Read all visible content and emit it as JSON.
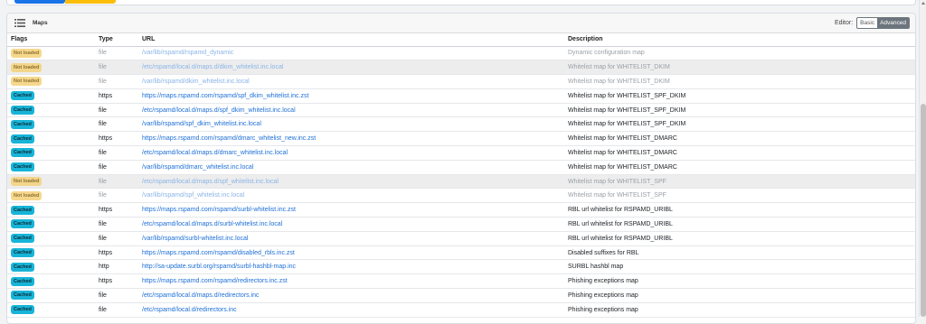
{
  "card": {
    "title": "Maps",
    "editor_label": "Editor:",
    "editor_basic": "Basic",
    "editor_advanced": "Advanced"
  },
  "table": {
    "headers": [
      "Flags",
      "Type",
      "URL",
      "Description"
    ],
    "rows": [
      {
        "flag": "Not loaded",
        "type": "file",
        "url": "/var/lib/rspamd/rspamd_dynamic",
        "desc": "Dynamic configuration map",
        "dim": true,
        "grey": false
      },
      {
        "flag": "Not loaded",
        "type": "file",
        "url": "/etc/rspamd/local.d/maps.d/dkim_whitelist.inc.local",
        "desc": "Whitelist map for WHITELIST_DKIM",
        "dim": true,
        "grey": true
      },
      {
        "flag": "Not loaded",
        "type": "file",
        "url": "/var/lib/rspamd/dkim_whitelist.inc.local",
        "desc": "Whitelist map for WHITELIST_DKIM",
        "dim": true,
        "grey": false
      },
      {
        "flag": "Cached",
        "type": "https",
        "url": "https://maps.rspamd.com/rspamd/spf_dkim_whitelist.inc.zst",
        "desc": "Whitelist map for WHITELIST_SPF_DKIM",
        "dim": false,
        "grey": false
      },
      {
        "flag": "Cached",
        "type": "file",
        "url": "/etc/rspamd/local.d/maps.d/spf_dkim_whitelist.inc.local",
        "desc": "Whitelist map for WHITELIST_SPF_DKIM",
        "dim": false,
        "grey": false
      },
      {
        "flag": "Cached",
        "type": "file",
        "url": "/var/lib/rspamd/spf_dkim_whitelist.inc.local",
        "desc": "Whitelist map for WHITELIST_SPF_DKIM",
        "dim": false,
        "grey": false
      },
      {
        "flag": "Cached",
        "type": "https",
        "url": "https://maps.rspamd.com/rspamd/dmarc_whitelist_new.inc.zst",
        "desc": "Whitelist map for WHITELIST_DMARC",
        "dim": false,
        "grey": false
      },
      {
        "flag": "Cached",
        "type": "file",
        "url": "/etc/rspamd/local.d/maps.d/dmarc_whitelist.inc.local",
        "desc": "Whitelist map for WHITELIST_DMARC",
        "dim": false,
        "grey": false
      },
      {
        "flag": "Cached",
        "type": "file",
        "url": "/var/lib/rspamd/dmarc_whitelist.inc.local",
        "desc": "Whitelist map for WHITELIST_DMARC",
        "dim": false,
        "grey": false
      },
      {
        "flag": "Not loaded",
        "type": "file",
        "url": "/etc/rspamd/local.d/maps.d/spf_whitelist.inc.local",
        "desc": "Whitelist map for WHITELIST_SPF",
        "dim": true,
        "grey": true
      },
      {
        "flag": "Not loaded",
        "type": "file",
        "url": "/var/lib/rspamd/spf_whitelist.inc.local",
        "desc": "Whitelist map for WHITELIST_SPF",
        "dim": true,
        "grey": false
      },
      {
        "flag": "Cached",
        "type": "https",
        "url": "https://maps.rspamd.com/rspamd/surbl-whitelist.inc.zst",
        "desc": "RBL url whitelist for RSPAMD_URIBL",
        "dim": false,
        "grey": false
      },
      {
        "flag": "Cached",
        "type": "file",
        "url": "/etc/rspamd/local.d/maps.d/surbl-whitelist.inc.local",
        "desc": "RBL url whitelist for RSPAMD_URIBL",
        "dim": false,
        "grey": false
      },
      {
        "flag": "Cached",
        "type": "file",
        "url": "/var/lib/rspamd/surbl-whitelist.inc.local",
        "desc": "RBL url whitelist for RSPAMD_URIBL",
        "dim": false,
        "grey": false
      },
      {
        "flag": "Cached",
        "type": "https",
        "url": "https://maps.rspamd.com/rspamd/disabled_rbls.inc.zst",
        "desc": "Disabled suffixes for RBL",
        "dim": false,
        "grey": false
      },
      {
        "flag": "Cached",
        "type": "http",
        "url": "http://sa-update.surbl.org/rspamd/surbl-hashbl-map.inc",
        "desc": "SURBL hashbl map",
        "dim": false,
        "grey": false
      },
      {
        "flag": "Cached",
        "type": "https",
        "url": "https://maps.rspamd.com/rspamd/redirectors.inc.zst",
        "desc": "Phishing exceptions map",
        "dim": false,
        "grey": false
      },
      {
        "flag": "Cached",
        "type": "file",
        "url": "/etc/rspamd/local.d/maps.d/redirectors.inc",
        "desc": "Phishing exceptions map",
        "dim": false,
        "grey": false
      },
      {
        "flag": "Cached",
        "type": "file",
        "url": "/etc/rspamd/local.d/redirectors.inc",
        "desc": "Phishing exceptions map",
        "dim": false,
        "grey": false
      }
    ]
  },
  "colors": {
    "cached_badge": "#17b4d8",
    "not_loaded_badge": "#f5d27a",
    "link": "#1d6fd6",
    "primary": "#1a73e8",
    "warning": "#fbbd08"
  }
}
